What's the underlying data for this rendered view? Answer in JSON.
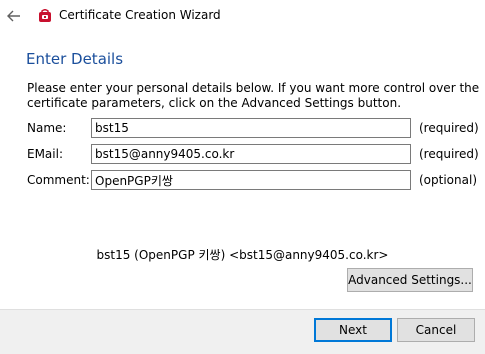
{
  "window": {
    "title": "Certificate Creation Wizard",
    "back_icon": "back-arrow-icon",
    "app_icon": "certificate-app-icon"
  },
  "page": {
    "heading": "Enter Details",
    "intro_line1": "Please enter your personal details below. If you want more control over the",
    "intro_line2": "certificate parameters, click on the Advanced Settings button."
  },
  "form": {
    "name": {
      "label": "Name:",
      "value": "bst15",
      "note": "(required)"
    },
    "email": {
      "label": "EMail:",
      "value": "bst15@anny9405.co.kr",
      "note": "(required)"
    },
    "comment": {
      "label": "Comment:",
      "value": "OpenPGP키쌍",
      "note": "(optional)"
    }
  },
  "summary": "bst15 (OpenPGP 키쌍) <bst15@anny9405.co.kr>",
  "buttons": {
    "advanced": "Advanced Settings...",
    "next": "Next",
    "cancel": "Cancel"
  },
  "colors": {
    "heading": "#1b4f9c",
    "footer_bg": "#f0f0f0",
    "button_bg": "#e1e1e1",
    "default_button_border": "#0078d7",
    "app_icon": "#c8102e"
  }
}
